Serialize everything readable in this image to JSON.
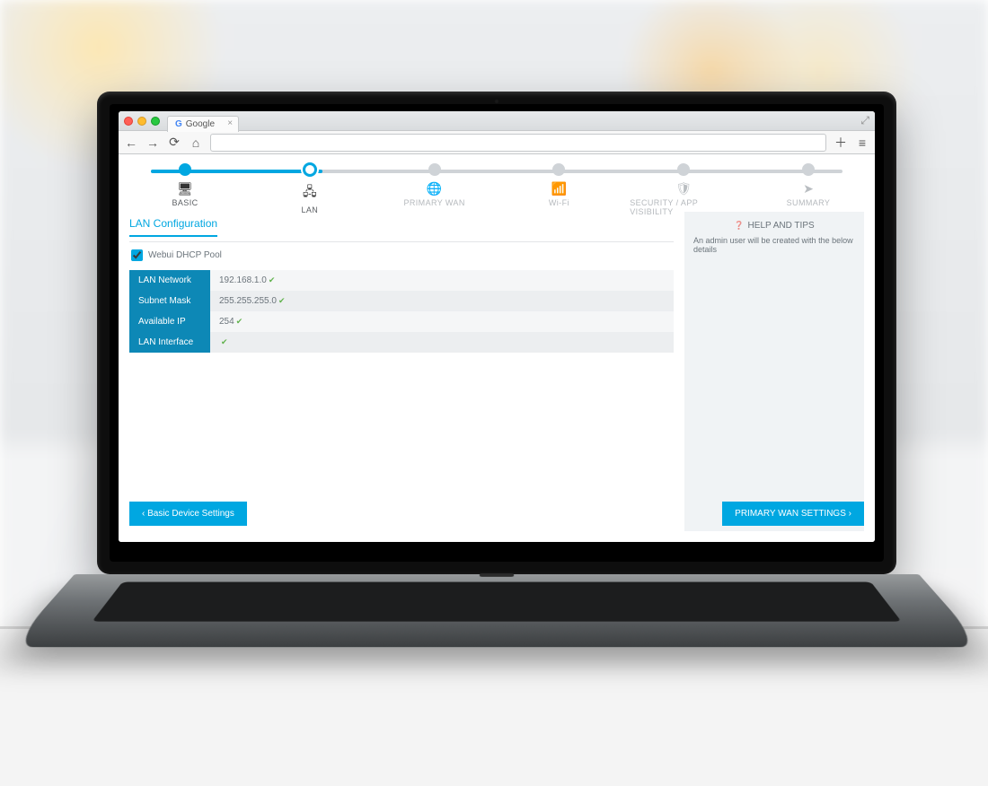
{
  "browser": {
    "tab_title": "Google",
    "url": ""
  },
  "stepper": [
    {
      "label": "BASIC",
      "icon": "monitor-icon",
      "state": "done"
    },
    {
      "label": "LAN",
      "icon": "network-icon",
      "state": "current"
    },
    {
      "label": "PRIMARY WAN",
      "icon": "globe-icon",
      "state": "todo"
    },
    {
      "label": "Wi-Fi",
      "icon": "wifi-icon",
      "state": "todo"
    },
    {
      "label": "SECURITY / APP VISIBILITY",
      "icon": "shield-icon",
      "state": "todo"
    },
    {
      "label": "SUMMARY",
      "icon": "send-icon",
      "state": "todo"
    }
  ],
  "section": {
    "title": "LAN Configuration",
    "checkbox_label": "Webui DHCP Pool",
    "checkbox_checked": true,
    "rows": [
      {
        "key": "LAN Network",
        "value": "192.168.1.0",
        "valid": true
      },
      {
        "key": "Subnet Mask",
        "value": "255.255.255.0",
        "valid": true
      },
      {
        "key": "Available IP",
        "value": "254",
        "valid": true
      },
      {
        "key": "LAN Interface",
        "value": "",
        "valid": true
      }
    ]
  },
  "help": {
    "title": "HELP AND TIPS",
    "body": "An admin user will be created with the below details"
  },
  "buttons": {
    "back": "‹ Basic Device Settings",
    "next": "PRIMARY WAN SETTINGS  ›"
  }
}
